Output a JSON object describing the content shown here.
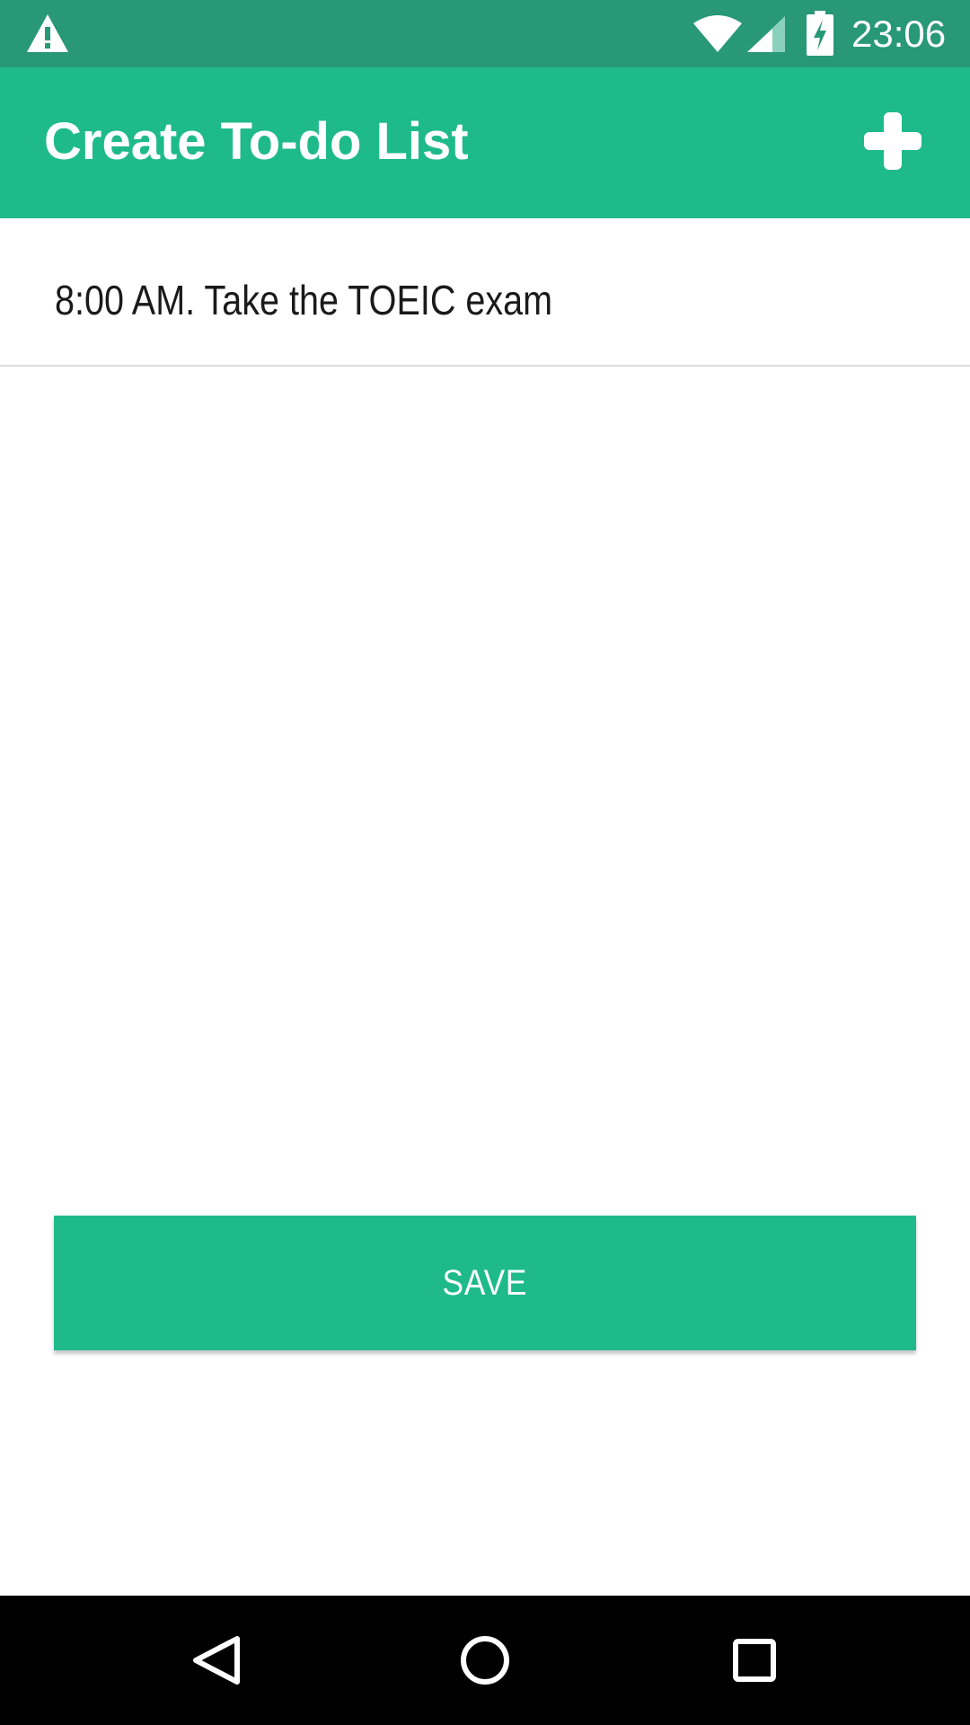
{
  "status_bar": {
    "time": "23:06",
    "icons": [
      "warning-icon",
      "wifi-icon",
      "cell-signal-icon",
      "battery-charging-icon"
    ]
  },
  "app_bar": {
    "title": "Create To-do List",
    "action_icon": "plus-icon"
  },
  "todo_list": {
    "items": [
      {
        "text": "8:00 AM. Take the TOEIC exam"
      }
    ]
  },
  "save_button": {
    "label": "SAVE"
  },
  "nav_bar": {
    "icons": [
      "back-icon",
      "home-icon",
      "recent-apps-icon"
    ]
  },
  "colors": {
    "status_bar": "#289877",
    "primary": "#1fba8a",
    "nav_bar": "#000000",
    "divider": "#dddddd"
  }
}
